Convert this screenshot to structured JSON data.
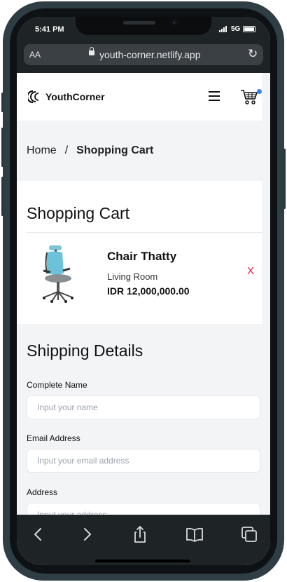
{
  "status_bar": {
    "time": "5:41 PM",
    "network": "5G"
  },
  "browser": {
    "text_size_label": "AA",
    "url": "youth-corner.netlify.app"
  },
  "header": {
    "brand": "YouthCorner"
  },
  "breadcrumb": {
    "home": "Home",
    "separator": "/",
    "current": "Shopping Cart"
  },
  "cart": {
    "title": "Shopping Cart",
    "items": [
      {
        "name": "Chair Thatty",
        "category": "Living Room",
        "price": "IDR 12,000,000.00",
        "remove_label": "X"
      }
    ]
  },
  "shipping": {
    "title": "Shipping Details",
    "fields": [
      {
        "label": "Complete Name",
        "placeholder": "Input your name"
      },
      {
        "label": "Email Address",
        "placeholder": "Input your email address"
      },
      {
        "label": "Address",
        "placeholder": "Input your address"
      }
    ]
  },
  "icons": {
    "cart": "cart-icon",
    "menu": "hamburger-icon",
    "reload": "reload-icon",
    "lock": "lock-icon",
    "back": "chevron-left-icon",
    "forward": "chevron-right-icon",
    "share": "share-icon",
    "bookmarks": "book-icon",
    "tabs": "tabs-icon"
  },
  "colors": {
    "accent_dot": "#3b82f6",
    "remove": "#e11d48",
    "frame": "#2f3d45"
  }
}
